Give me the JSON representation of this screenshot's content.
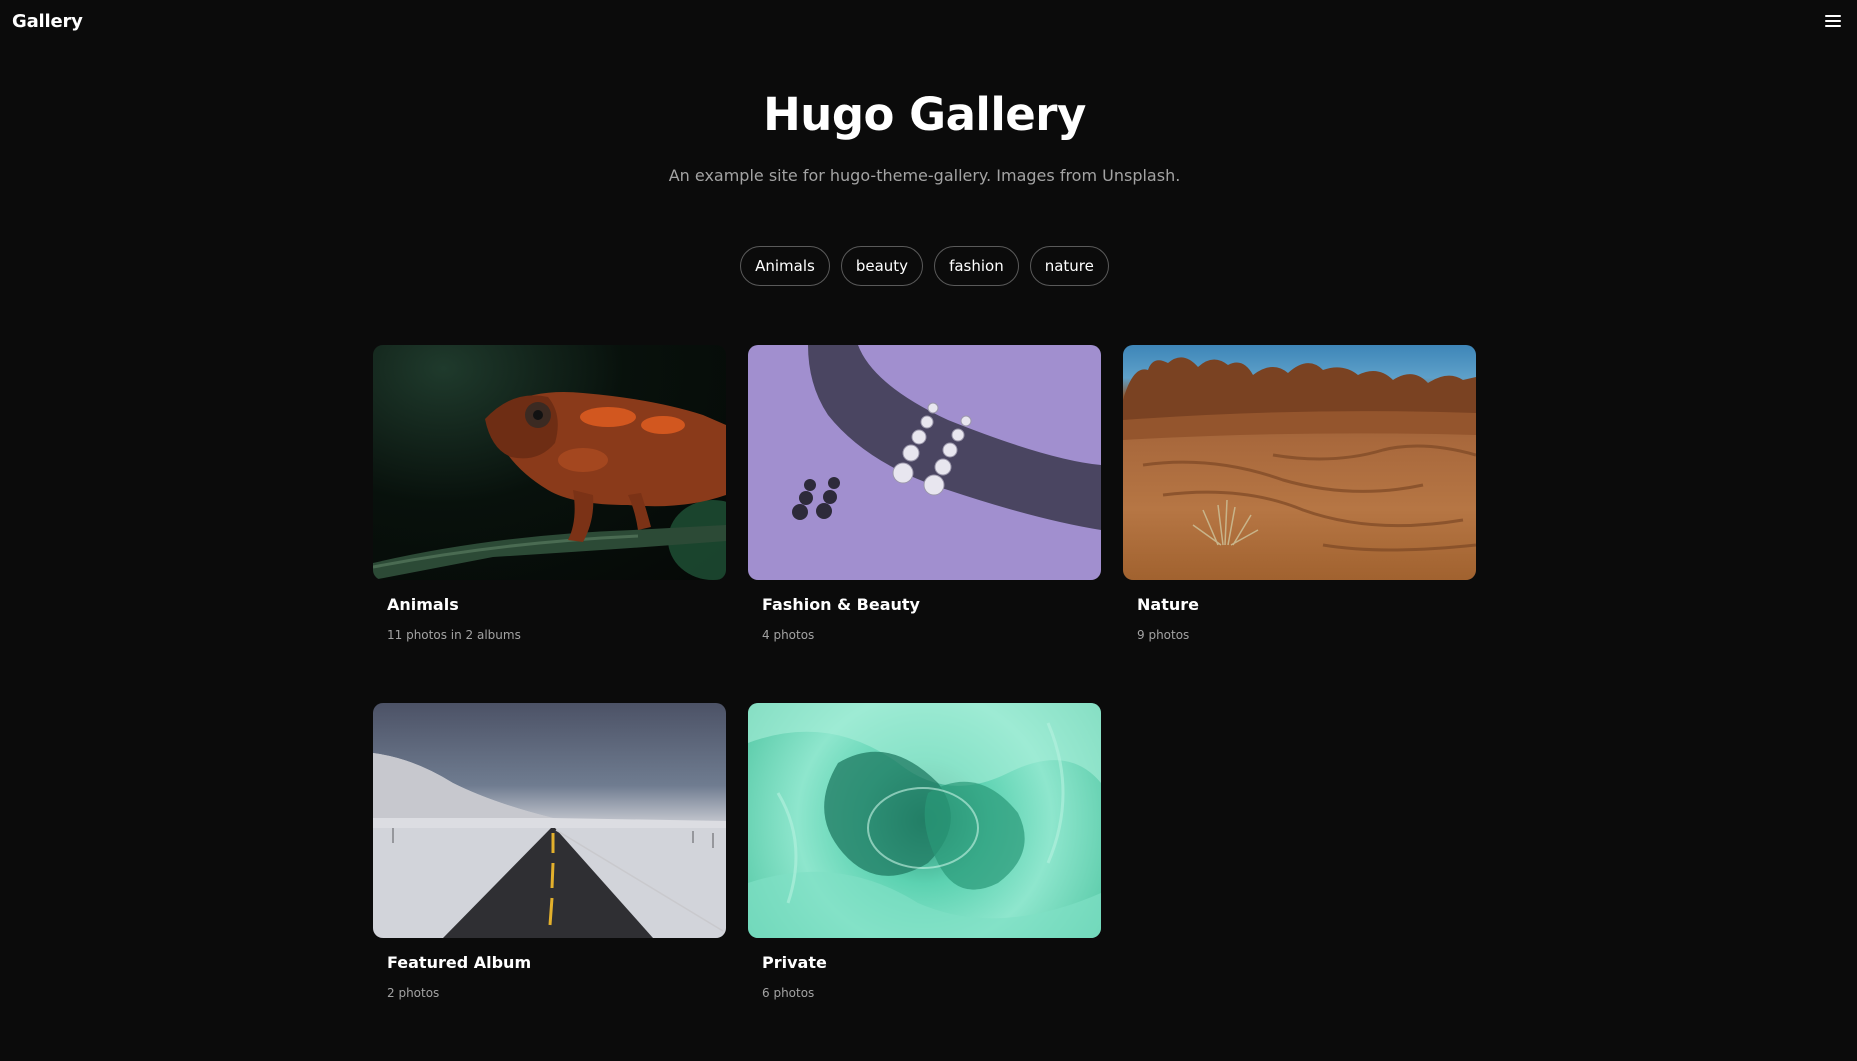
{
  "nav": {
    "brand": "Gallery",
    "menu_icon": "hamburger-menu-icon"
  },
  "hero": {
    "title": "Hugo Gallery",
    "subtitle": "An example site for hugo-theme-gallery. Images from Unsplash."
  },
  "tags": [
    {
      "label": "Animals"
    },
    {
      "label": "beauty"
    },
    {
      "label": "fashion"
    },
    {
      "label": "nature"
    }
  ],
  "albums": [
    {
      "title": "Animals",
      "meta": "11 photos in 2 albums",
      "image": "chameleon-photo"
    },
    {
      "title": "Fashion & Beauty",
      "meta": "4 photos",
      "image": "earrings-photo"
    },
    {
      "title": "Nature",
      "meta": "9 photos",
      "image": "desert-photo"
    },
    {
      "title": "Featured Album",
      "meta": "2 photos",
      "image": "snowy-road-photo"
    },
    {
      "title": "Private",
      "meta": "6 photos",
      "image": "abstract-teal-photo"
    }
  ],
  "colors": {
    "background": "#0b0b0b",
    "text": "#ffffff",
    "muted": "#a3a3a3",
    "tag_border": "#5a5a5a"
  }
}
